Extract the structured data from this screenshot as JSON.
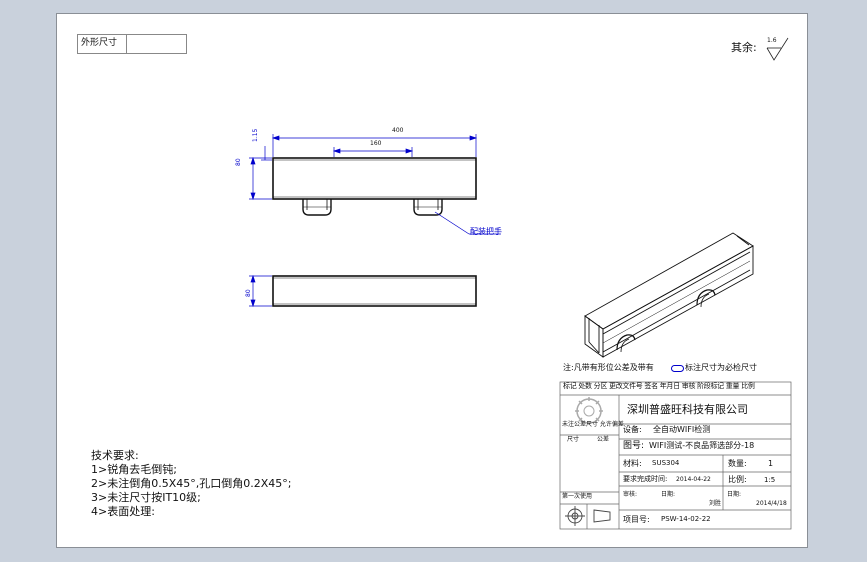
{
  "header": {
    "outline_label": "外形尺寸",
    "remaining_label": "其余:",
    "remaining_value": "1.6"
  },
  "drawing": {
    "dim_width": "400",
    "dim_hole_spacing": "160",
    "dim_height_front": "80",
    "dim_height_side": "80",
    "dim_small": "1.15",
    "callout_label": "配装把手"
  },
  "title_block": {
    "note_prefix": "注:凡带有形位公差及带有",
    "note_suffix": "标注尺寸为必检尺寸",
    "header_row": "标记 处数 分区 更改文件号 签名 年月日 审核 阶段标记 重量 比例",
    "company": "深圳普盛旺科技有限公司",
    "device_label": "设备:",
    "device_value": "全自动WIFI检测",
    "drawing_name_label": "图号:",
    "drawing_name_value": "WIFI测试-不良品筛选部分-18",
    "material_label": "材料:",
    "material_value": "SUS304",
    "qty_label": "数量:",
    "qty_value": "1",
    "finish_label": "要求完成时间:",
    "finish_value": "2014-04-22",
    "scale_label": "比例:",
    "scale_value": "1:5",
    "review_label": "审核:",
    "date_label": "日期:",
    "designer_value": "刘胜",
    "design_date": "2014/4/18",
    "project_label": "项目号:",
    "project_value": "PSW-14-02-22",
    "first_use_label": "第一次使用",
    "tolerance_title": "未注公差尺寸 允许偏差",
    "size_label": "尺寸",
    "tolerance_label": "公差"
  },
  "tech_requirements": {
    "title": "技术要求:",
    "items": [
      "1>锐角去毛倒钝;",
      "2>未注倒角0.5X45°,孔口倒角0.2X45°;",
      "3>未注尺寸按IT10级;",
      "4>表面处理:"
    ]
  }
}
